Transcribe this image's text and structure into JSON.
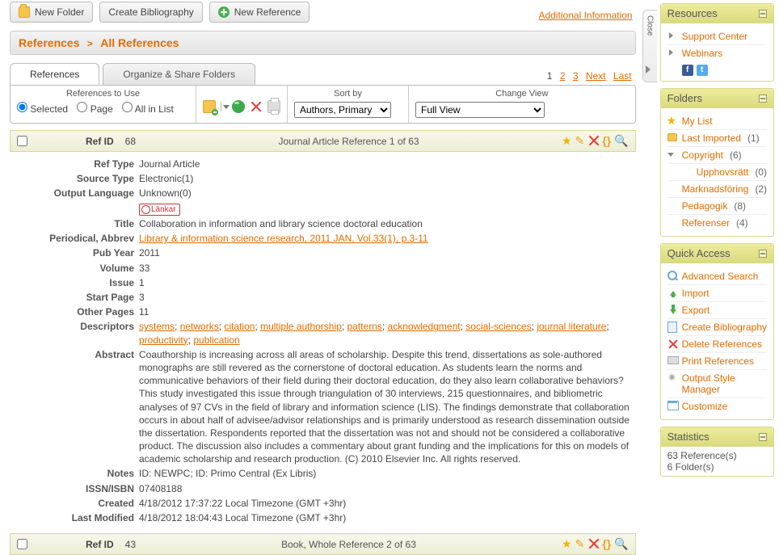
{
  "top": {
    "new_folder": "New Folder",
    "create_bib": "Create Bibliography",
    "new_ref": "New Reference",
    "addl_info": "Additional Information",
    "close_label": "Close"
  },
  "crumbs": {
    "root": "References",
    "current": "All References"
  },
  "tabs": {
    "references": "References",
    "organize": "Organize & Share Folders"
  },
  "pager": {
    "current": "1",
    "p2": "2",
    "p3": "3",
    "next": "Next",
    "last": "Last"
  },
  "toolbar": {
    "refs_to_use": "References to Use",
    "opt_selected": "Selected",
    "opt_page": "Page",
    "opt_all": "All in List",
    "sort_label": "Sort by",
    "sort_value": "Authors, Primary",
    "view_label": "Change View",
    "view_value": "Full View"
  },
  "ref1": {
    "header": {
      "refid_label": "Ref ID",
      "refid": "68",
      "title": "Journal Article Reference 1 of 63"
    },
    "labels": {
      "ref_type": "Ref Type",
      "source_type": "Source Type",
      "output_lang": "Output Language",
      "title": "Title",
      "periodical": "Periodical, Abbrev",
      "pub_year": "Pub Year",
      "volume": "Volume",
      "issue": "Issue",
      "start_page": "Start Page",
      "other_pages": "Other Pages",
      "descriptors": "Descriptors",
      "abstract": "Abstract",
      "notes": "Notes",
      "issn": "ISSN/ISBN",
      "created": "Created",
      "modified": "Last Modified"
    },
    "values": {
      "ref_type": "Journal Article",
      "source_type": "Electronic(1)",
      "output_lang": "Unknown(0)",
      "lankar": "Länkar",
      "title": "Collaboration in information and library science doctoral education",
      "periodical": "Library & information science research, 2011 JAN, Vol.33(1), p.3-11",
      "pub_year": "2011",
      "volume": "33",
      "issue": "1",
      "start_page": "3",
      "other_pages": "11",
      "descriptors": [
        "systems",
        "networks",
        "citation",
        "multiple authorship",
        "patterns",
        "acknowledgment",
        "social-sciences",
        "journal literature",
        "productivity",
        "publication"
      ],
      "abstract": "Coauthorship is increasing across all areas of scholarship. Despite this trend, dissertations as sole-authored monographs are still revered as the cornerstone of doctoral education. As students learn the norms and communicative behaviors of their field during their doctoral education, do they also learn collaborative behaviors? This study investigated this issue through triangulation of 30 interviews, 215 questionnaires, and bibliometric analyses of 97 CVs in the field of library and information science (LIS). The findings demonstrate that collaboration occurs in about half of advisee/advisor relationships and is primarily understood as research dissemination outside the dissertation. Respondents reported that the dissertation was not and should not be considered a collaborative product. The discussion also includes a commentary about grant funding and the implications for this on models of academic scholarship and research production. (C) 2010 Elsevier Inc. All rights reserved.",
      "notes": "ID: NEWPC; ID: Primo Central (Ex Libris)",
      "issn": "07408188",
      "created": "4/18/2012 17:37:22 Local Timezone (GMT +3hr)",
      "modified": "4/18/2012 18:04:43 Local Timezone (GMT +3hr)"
    }
  },
  "ref2": {
    "header": {
      "refid_label": "Ref ID",
      "refid": "43",
      "title": "Book, Whole Reference 2 of 63"
    }
  },
  "side": {
    "resources": {
      "title": "Resources",
      "items": [
        "Support Center",
        "Webinars"
      ]
    },
    "folders": {
      "title": "Folders",
      "my_list": "My List",
      "last_imported": "Last Imported",
      "last_imported_count": "(1)",
      "copyright": "Copyright",
      "copyright_count": "(6)",
      "upph": "Upphovsrätt",
      "upph_count": "(0)",
      "mark": "Marknadsföring",
      "mark_count": "(2)",
      "peda": "Pedagogik",
      "peda_count": "(8)",
      "refs": "Referenser",
      "refs_count": "(4)"
    },
    "quick": {
      "title": "Quick Access",
      "items": {
        "adv": "Advanced Search",
        "imp": "Import",
        "exp": "Export",
        "bib": "Create Bibliography",
        "del": "Delete References",
        "print": "Print References",
        "style": "Output Style Manager",
        "cust": "Customize"
      }
    },
    "stats": {
      "title": "Statistics",
      "l1": "63 Reference(s)",
      "l2": "6 Folder(s)"
    }
  }
}
